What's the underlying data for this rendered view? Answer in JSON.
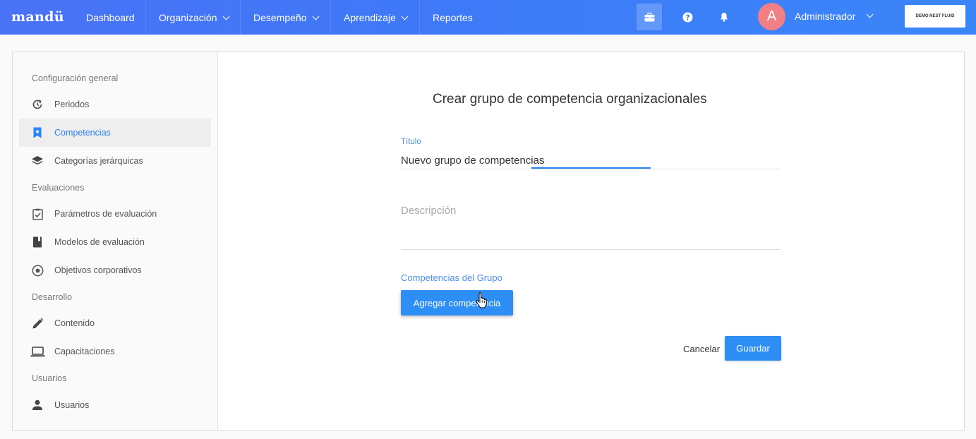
{
  "app": {
    "logo": "mandü"
  },
  "nav": {
    "items": [
      {
        "label": "Dashboard"
      },
      {
        "label": "Organización"
      },
      {
        "label": "Desempeño"
      },
      {
        "label": "Aprendizaje"
      },
      {
        "label": "Reportes"
      }
    ],
    "avatar_initial": "A",
    "user_name": "Administrador",
    "company": "DEMO NEST FLUID"
  },
  "sidebar": {
    "sections": [
      {
        "title": "Configuración general"
      },
      {
        "title": "Evaluaciones"
      },
      {
        "title": "Desarrollo"
      },
      {
        "title": "Usuarios"
      }
    ],
    "items": [
      {
        "label": "Periodos",
        "icon": "history-icon"
      },
      {
        "label": "Competencias",
        "icon": "bookmark-icon",
        "active": true
      },
      {
        "label": "Categorías jerárquicas",
        "icon": "layers-icon"
      },
      {
        "label": "Parámetros de evaluación",
        "icon": "clipboard-check-icon"
      },
      {
        "label": "Modelos de evaluación",
        "icon": "book-icon"
      },
      {
        "label": "Objetivos corporativos",
        "icon": "target-icon"
      },
      {
        "label": "Contenido",
        "icon": "pencil-icon"
      },
      {
        "label": "Capacitaciones",
        "icon": "laptop-icon"
      },
      {
        "label": "Usuarios",
        "icon": "person-icon"
      }
    ]
  },
  "form": {
    "title": "Crear grupo de competencia organizacionales",
    "title_field_label": "Título",
    "title_value": "Nuevo grupo de competencias",
    "description_placeholder": "Descripción",
    "group_label": "Competencias del Grupo",
    "add_button": "Agregar competencia",
    "cancel_button": "Cancelar",
    "save_button": "Guardar"
  },
  "colors": {
    "primary": "#2d8ef5",
    "nav_start": "#4a72f5",
    "nav_end": "#3a86f8",
    "avatar": "#f07f86"
  }
}
